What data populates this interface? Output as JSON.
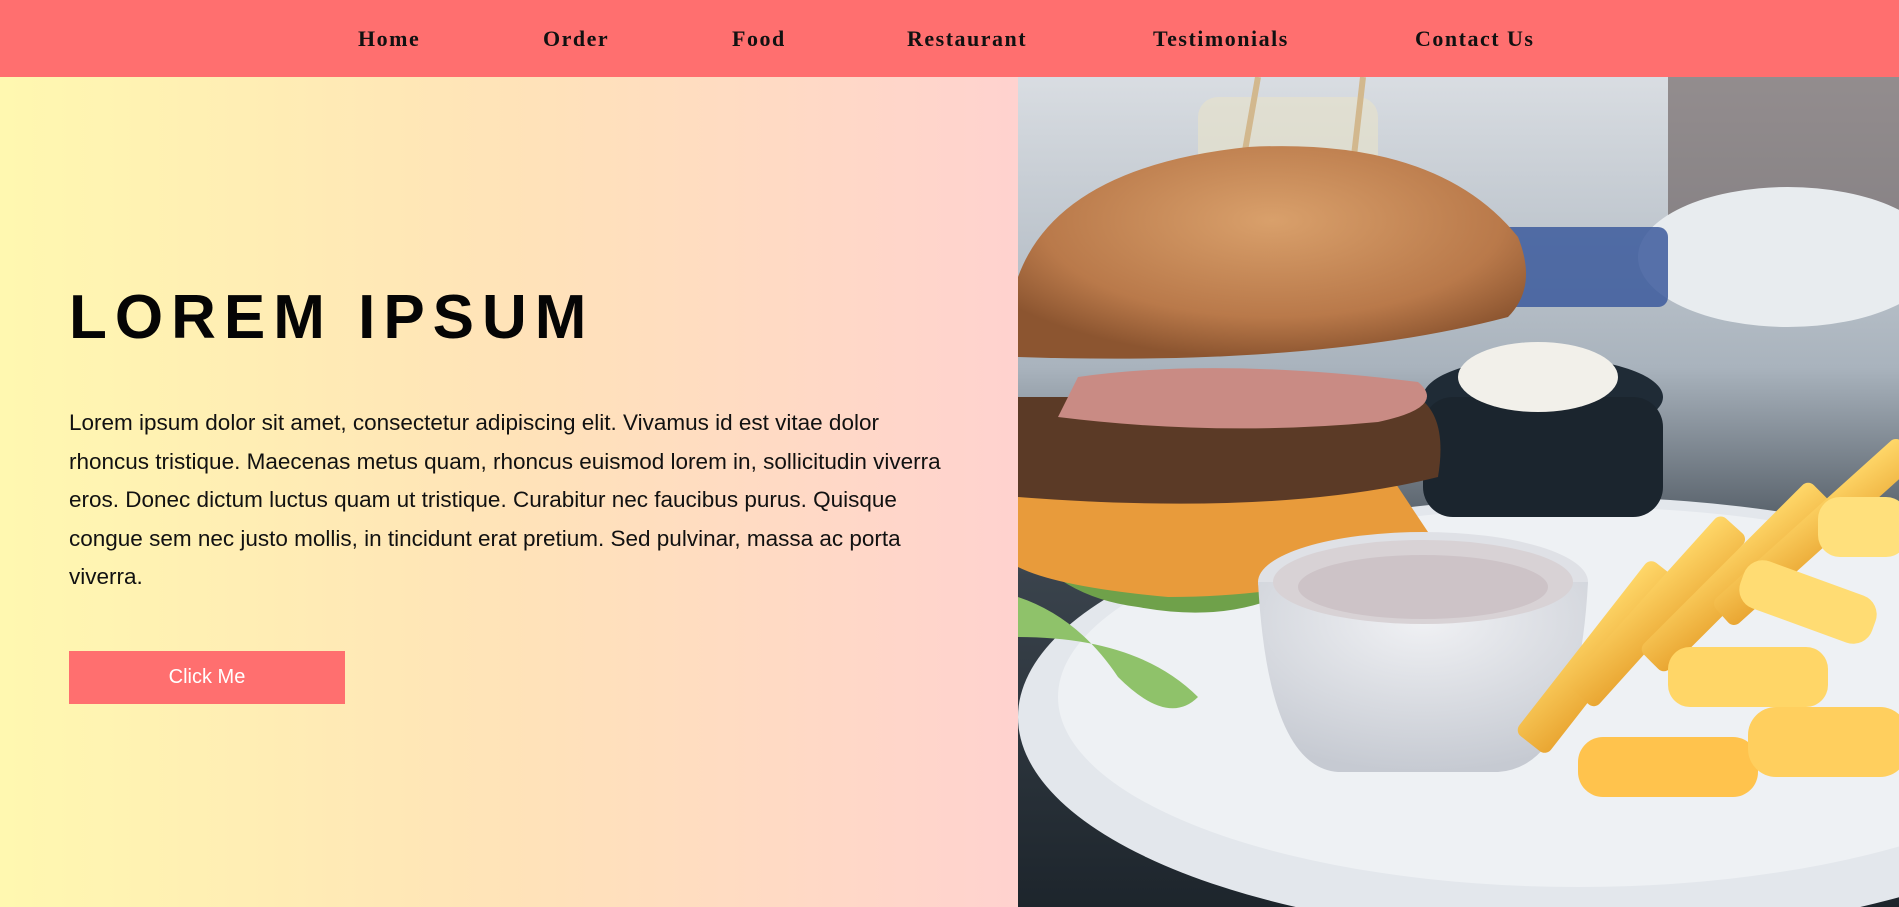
{
  "nav": {
    "items": [
      {
        "label": "Home"
      },
      {
        "label": "Order"
      },
      {
        "label": "Food"
      },
      {
        "label": "Restaurant"
      },
      {
        "label": "Testimonials"
      },
      {
        "label": "Contact Us"
      }
    ]
  },
  "hero": {
    "title": "LOREM IPSUM",
    "body": "Lorem ipsum dolor sit amet, consectetur adipiscing elit. Vivamus id est vitae dolor rhoncus tristique. Maecenas metus quam, rhoncus euismod lorem in, sollicitudin viverra eros. Donec dictum luctus quam ut tristique. Curabitur nec faucibus purus. Quisque congue sem nec justo mollis, in tincidunt erat pretium. Sed pulvinar, massa ac porta viverra.",
    "button_label": "Click Me",
    "image_subject": "burger-with-fries-photo"
  },
  "colors": {
    "nav_bg": "#ff6f6f",
    "button_bg": "#ff6f6f",
    "gradient_start": "#fff8b0",
    "gradient_end": "#ffd2cf"
  }
}
